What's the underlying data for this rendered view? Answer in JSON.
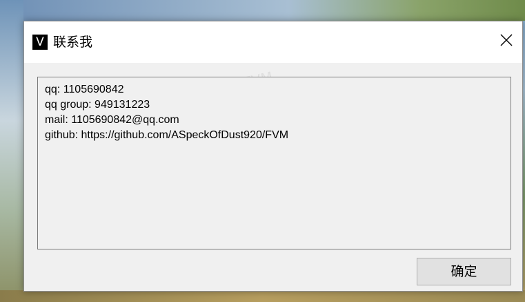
{
  "window": {
    "title": "联系我",
    "app_icon_letter": "V",
    "watermark": "FVM"
  },
  "content": {
    "lines": [
      "qq: 1105690842",
      "qq group: 949131223",
      "mail: 1105690842@qq.com",
      "github: https://github.com/ASpeckOfDust920/FVM"
    ]
  },
  "buttons": {
    "ok_label": "确定"
  },
  "icons": {
    "close": "close-icon",
    "app": "app-icon"
  },
  "colors": {
    "dialog_bg": "#f0f0f0",
    "titlebar_bg": "#ffffff",
    "button_bg": "#e1e1e1"
  }
}
